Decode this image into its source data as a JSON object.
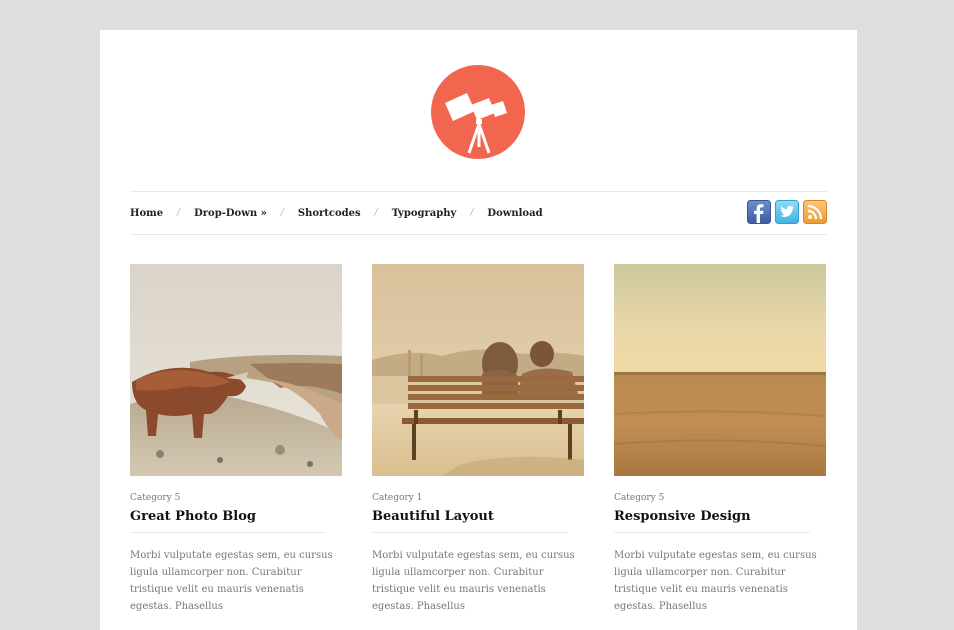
{
  "site": {
    "logo_icon": "telescope-icon",
    "accent": "#f2654e"
  },
  "nav": {
    "items": [
      {
        "label": "Home"
      },
      {
        "label": "Drop-Down »"
      },
      {
        "label": "Shortcodes"
      },
      {
        "label": "Typography"
      },
      {
        "label": "Download"
      }
    ],
    "separator": "/"
  },
  "social": [
    {
      "name": "facebook-icon",
      "label": "f"
    },
    {
      "name": "twitter-icon",
      "label": "t"
    },
    {
      "name": "rss-icon",
      "label": "rss"
    }
  ],
  "posts": [
    {
      "category": "Category 5",
      "title": "Great Photo Blog",
      "excerpt": "Morbi vulputate egestas sem, eu cursus ligula ullamcorper non. Curabitur tristique velit eu mauris venenatis egestas. Phasellus",
      "image": "highland-cow-photo"
    },
    {
      "category": "Category 1",
      "title": "Beautiful Layout",
      "excerpt": "Morbi vulputate egestas sem, eu cursus ligula ullamcorper non. Curabitur tristique velit eu mauris venenatis egestas. Phasellus",
      "image": "couple-on-bench-photo"
    },
    {
      "category": "Category 5",
      "title": "Responsive Design",
      "excerpt": "Morbi vulputate egestas sem, eu cursus ligula ullamcorper non. Curabitur tristique velit eu mauris venenatis egestas. Phasellus",
      "image": "wheat-field-photo"
    }
  ]
}
